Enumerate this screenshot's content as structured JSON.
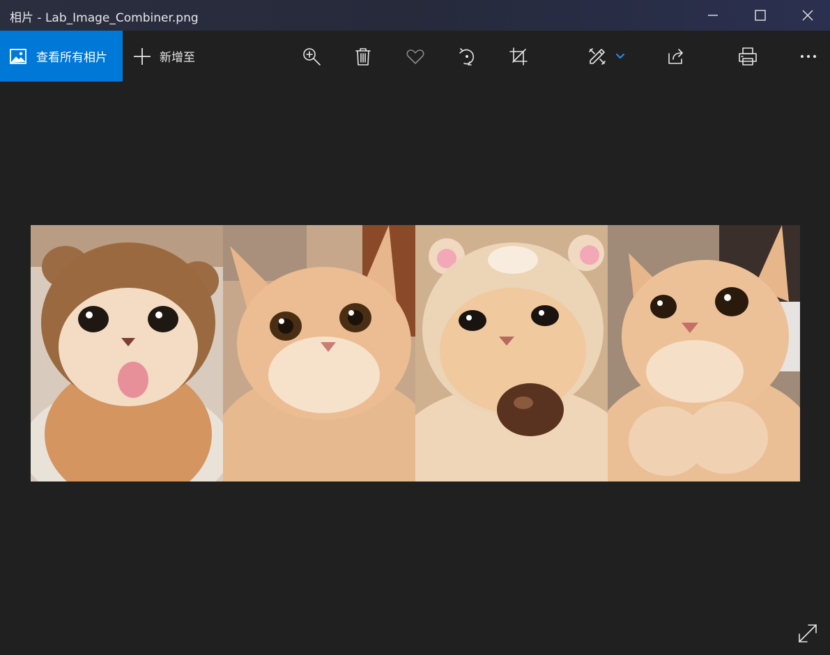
{
  "window": {
    "title": "相片 - Lab_Image_Combiner.png",
    "controls": [
      "minimize-icon",
      "maximize-icon",
      "close-icon"
    ]
  },
  "toolbar": {
    "see_all_label": "查看所有相片",
    "add_to_label": "新增至",
    "icons": [
      "zoom-in-icon",
      "delete-icon",
      "favorite-icon",
      "rotate-icon",
      "crop-icon",
      "edit-create-icon",
      "share-icon",
      "print-icon",
      "more-icon"
    ]
  },
  "image": {
    "panels": [
      "cat in brown bear hat with tongue out",
      "orange cat wide eyes",
      "cat in bear hood holding chestnut",
      "orange cat with paws together"
    ]
  },
  "colors": {
    "accent": "#0078d7",
    "background": "#202020",
    "titlebar": "#2a2e3e"
  }
}
